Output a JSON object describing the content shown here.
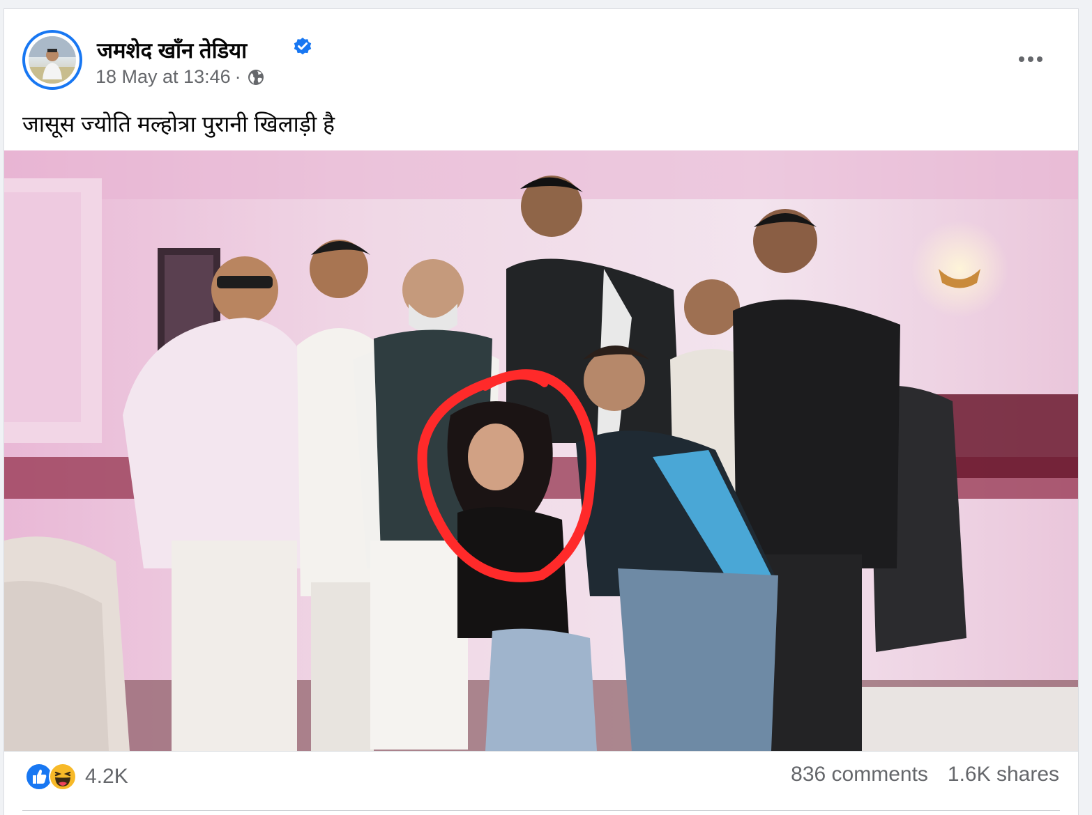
{
  "post": {
    "author": "जमशेद खाँन तेडिया",
    "timestamp": "18 May at 13:46",
    "separator": "·",
    "audience_icon": "globe-icon",
    "verified_icon": "verified-badge-icon",
    "more_icon": "more-options-icon",
    "caption": "जासूस ज्योति मल्होत्रा पुरानी खिलाड़ी है",
    "photo": {
      "subject": "group photo",
      "highlight_annotation": "red circle"
    },
    "reactions": {
      "icons": [
        "like-icon",
        "haha-icon"
      ],
      "count": "4.2K"
    },
    "comments": "836 comments",
    "shares": "1.6K shares"
  },
  "colors": {
    "accent": "#1877f2",
    "text_primary": "#050505",
    "text_secondary": "#65676b",
    "annotation": "#ff2a2a",
    "haha": "#f7b928"
  }
}
